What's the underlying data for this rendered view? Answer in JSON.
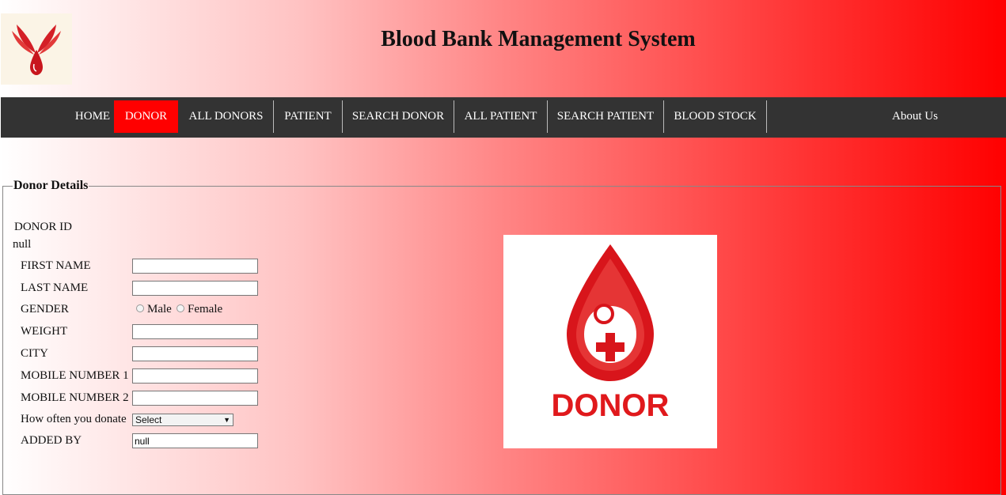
{
  "header": {
    "title": "Blood Bank Management System",
    "logo_icon": "blood-drop-hands-icon"
  },
  "nav": {
    "items": [
      {
        "label": "HOME"
      },
      {
        "label": "DONOR"
      },
      {
        "label": "ALL DONORS"
      },
      {
        "label": "PATIENT"
      },
      {
        "label": "SEARCH DONOR"
      },
      {
        "label": "ALL PATIENT"
      },
      {
        "label": "SEARCH PATIENT"
      },
      {
        "label": "BLOOD STOCK"
      },
      {
        "label": "About Us"
      }
    ],
    "active_item": "DONOR"
  },
  "form": {
    "legend": "Donor Details",
    "donor_id_label": "DONOR ID",
    "donor_id_value": "null",
    "first_name_label": "FIRST NAME",
    "first_name_value": "",
    "last_name_label": "LAST NAME",
    "last_name_value": "",
    "gender_label": "GENDER",
    "gender_options": [
      "Male",
      "Female"
    ],
    "weight_label": "WEIGHT",
    "weight_value": "",
    "city_label": "CITY",
    "city_value": "",
    "mobile1_label": "MOBILE NUMBER 1",
    "mobile1_value": "",
    "mobile2_label": "MOBILE NUMBER 2",
    "mobile2_value": "",
    "donate_freq_label": "How often you donate",
    "donate_freq_selected": "Select",
    "added_by_label": "ADDED BY",
    "added_by_value": "null"
  },
  "donor_image": {
    "icon": "donor-blood-drop-icon",
    "text": "DONOR"
  },
  "colors": {
    "accent": "#ff0000",
    "nav_bg": "#333333",
    "nav_text": "#ffffff"
  }
}
